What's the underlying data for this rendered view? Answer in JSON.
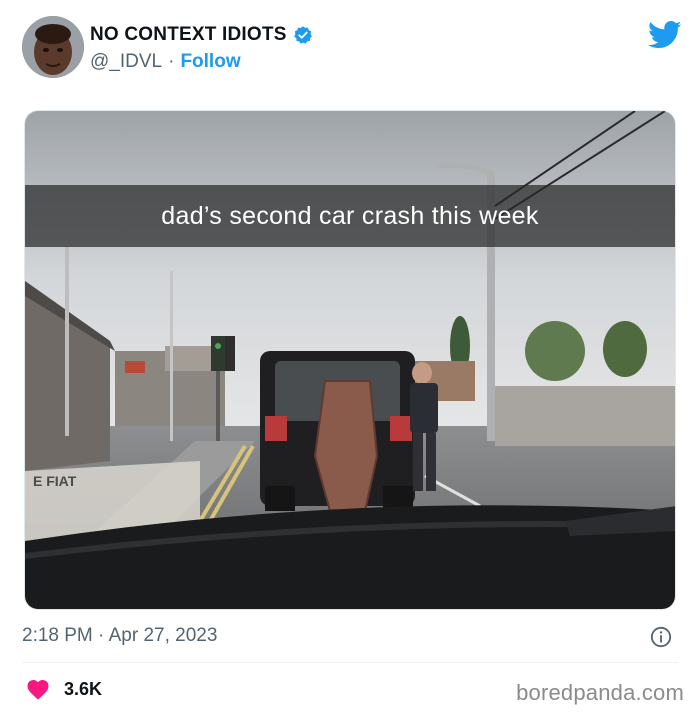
{
  "account": {
    "name": "NO CONTEXT IDIOTS",
    "handle": "@_IDVL",
    "separator": "·",
    "follow_label": "Follow",
    "verified": true
  },
  "post": {
    "image_caption": "dad’s second car crash this week",
    "image_sign_text": "E FIAT",
    "timestamp": "2:18 PM · Apr 27, 2023"
  },
  "stats": {
    "likes": "3.6K"
  },
  "watermark": "boredpanda.com",
  "colors": {
    "accent": "#1d9bf0",
    "heart": "#f91880",
    "text_secondary": "#536471"
  },
  "icons": {
    "verified": "verified-badge-icon",
    "twitter": "twitter-bird-icon",
    "info": "info-icon",
    "like": "heart-icon"
  }
}
